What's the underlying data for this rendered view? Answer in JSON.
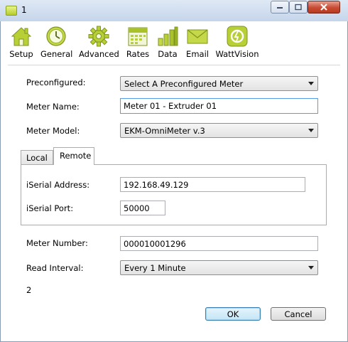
{
  "window": {
    "title": "1"
  },
  "toolbar": {
    "items": [
      {
        "label": "Setup",
        "icon": "house-icon"
      },
      {
        "label": "General",
        "icon": "clock-icon"
      },
      {
        "label": "Advanced",
        "icon": "gear-icon"
      },
      {
        "label": "Rates",
        "icon": "calendar-icon"
      },
      {
        "label": "Data",
        "icon": "bar-chart-icon"
      },
      {
        "label": "Email",
        "icon": "envelope-icon"
      },
      {
        "label": "WattVision",
        "icon": "wattvision-icon"
      }
    ]
  },
  "form": {
    "preconfigured": {
      "label": "Preconfigured:",
      "value": "Select A Preconfigured Meter"
    },
    "meter_name": {
      "label": "Meter Name:",
      "value": "Meter 01 - Extruder 01"
    },
    "meter_model": {
      "label": "Meter Model:",
      "value": "EKM-OmniMeter v.3"
    },
    "tabs": [
      {
        "label": "Local"
      },
      {
        "label": "Remote"
      }
    ],
    "remote": {
      "iserial_address": {
        "label": "iSerial Address:",
        "value": "192.168.49.129"
      },
      "iserial_port": {
        "label": "iSerial Port:",
        "value": "50000"
      }
    },
    "meter_number": {
      "label": "Meter Number:",
      "value": "000010001296"
    },
    "read_interval": {
      "label": "Read Interval:",
      "value": "Every 1 Minute"
    },
    "status_text": "2"
  },
  "buttons": {
    "ok": "OK",
    "cancel": "Cancel"
  },
  "colors": {
    "accent": "#a8c41e",
    "close_button": "#c74b33",
    "focus_border": "#569de5"
  }
}
